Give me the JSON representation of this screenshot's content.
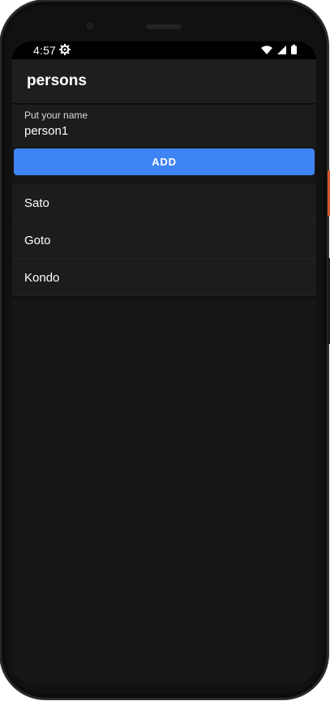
{
  "status_bar": {
    "time": "4:57",
    "icons": [
      "settings-icon",
      "wifi-icon",
      "signal-icon",
      "battery-icon"
    ]
  },
  "app_bar": {
    "title": "persons"
  },
  "name_input": {
    "label": "Put your name",
    "value": "person1"
  },
  "add_button": {
    "label": "ADD"
  },
  "persons": [
    {
      "name": "Sato"
    },
    {
      "name": "Goto"
    },
    {
      "name": "Kondo"
    }
  ],
  "colors": {
    "accent": "#3f84f5",
    "background": "#161616",
    "surface": "#1e1e1e",
    "text": "#ffffff"
  }
}
